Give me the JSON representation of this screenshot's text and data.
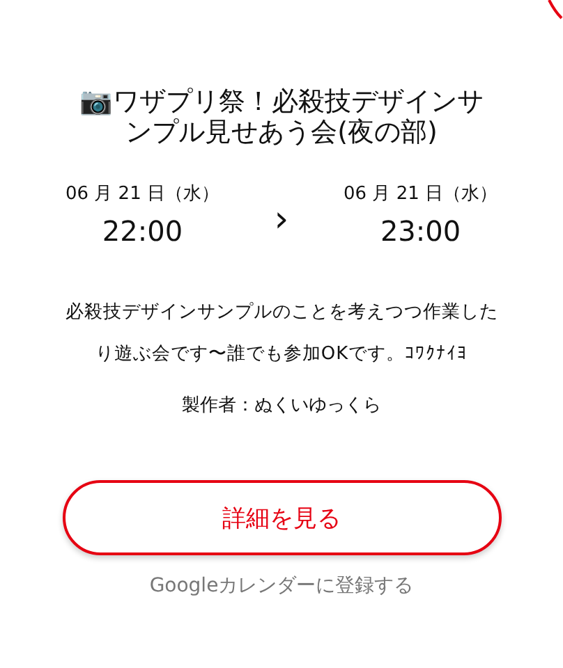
{
  "title": "📷ワザプリ祭！必殺技デザインサンプル見せあう会(夜の部)",
  "start": {
    "date": "06 月 21 日（水）",
    "time": "22:00"
  },
  "separator": "›",
  "end": {
    "date": "06 月 21 日（水）",
    "time": "23:00"
  },
  "description": "必殺技デザインサンプルのことを考えつつ作業したり遊ぶ会です〜誰でも参加OKです。ｺﾜｸﾅｲﾖ",
  "author": "製作者：ぬくいゆっくら",
  "details_button": "詳細を見る",
  "calendar_link": "Googleカレンダーに登録する"
}
